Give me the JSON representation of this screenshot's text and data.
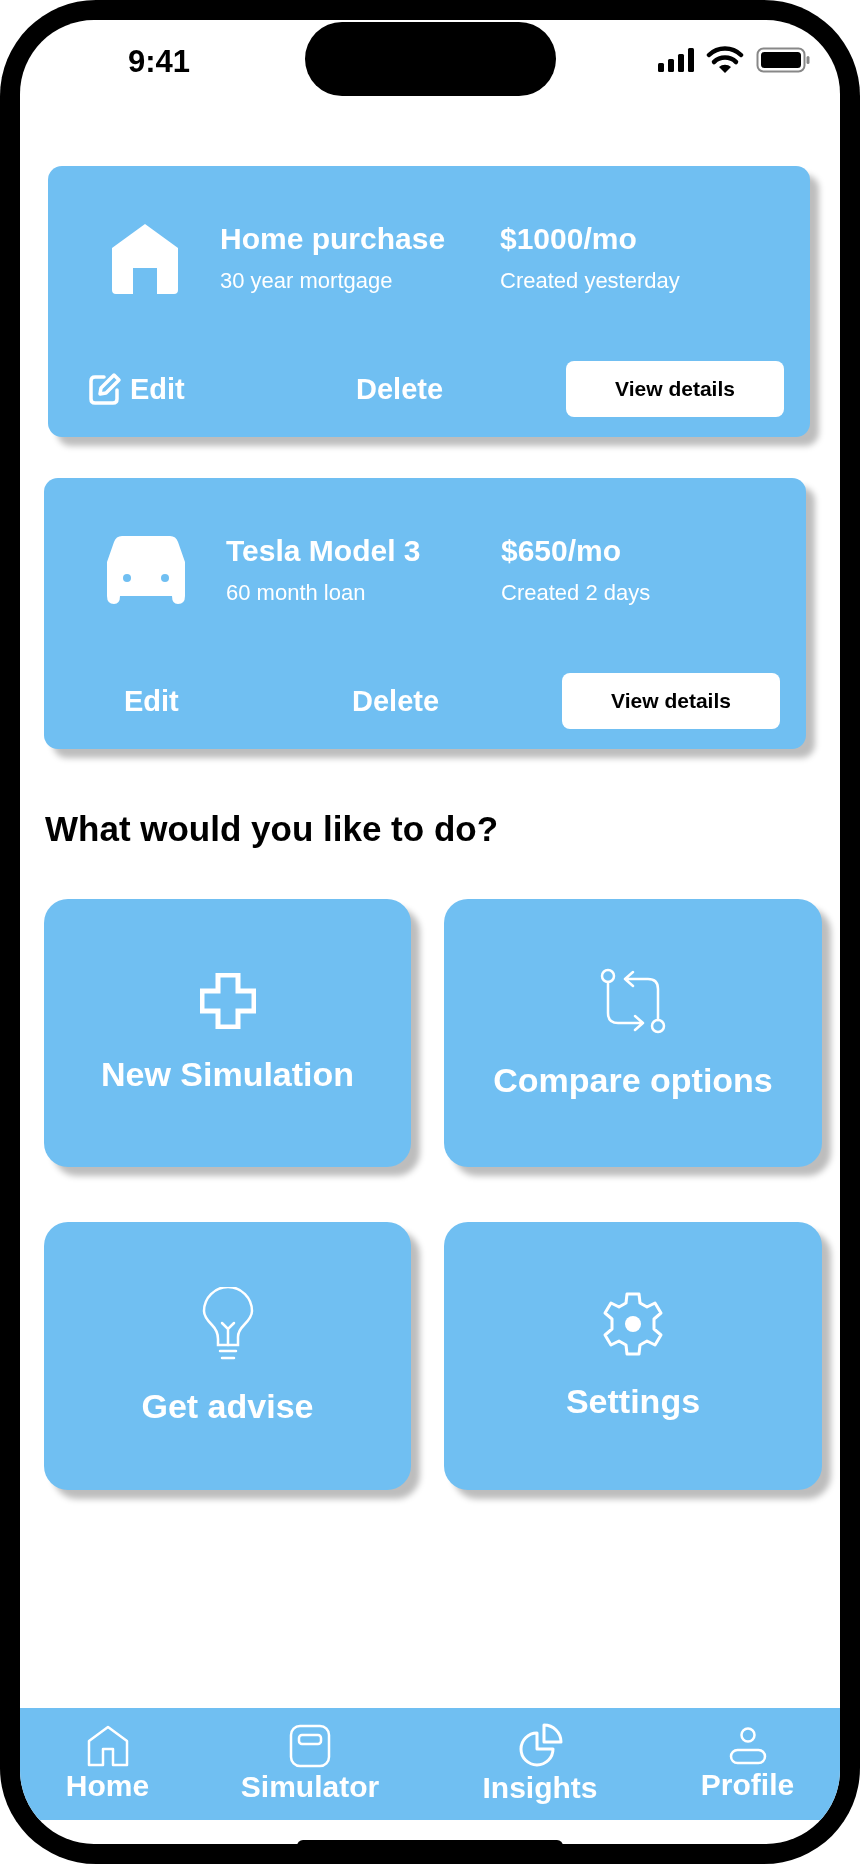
{
  "status_bar": {
    "time": "9:41"
  },
  "plans": [
    {
      "kind": "house",
      "title": "Home purchase",
      "subtitle": "30 year mortgage",
      "amount": "$1000/mo",
      "created": "Created yesterday",
      "edit": {
        "label": "Edit",
        "show_icon": true
      },
      "delete": "Delete",
      "details": "View details"
    },
    {
      "kind": "car",
      "title": "Tesla Model 3",
      "subtitle": "60 month loan",
      "amount": "$650/mo",
      "created": "Created 2 days",
      "edit": {
        "label": "Edit",
        "show_icon": false
      },
      "delete": "Delete",
      "details": "View details"
    }
  ],
  "heading": "What would you like to do?",
  "actions": [
    {
      "kind": "plus",
      "label": "New Simulation"
    },
    {
      "kind": "compare",
      "label": "Compare options"
    },
    {
      "kind": "bulb",
      "label": "Get advise"
    },
    {
      "kind": "gear",
      "label": "Settings"
    }
  ],
  "nav": [
    {
      "kind": "home",
      "label": "Home"
    },
    {
      "kind": "simulator",
      "label": "Simulator"
    },
    {
      "kind": "insights",
      "label": "Insights"
    },
    {
      "kind": "profile",
      "label": "Profile"
    }
  ]
}
